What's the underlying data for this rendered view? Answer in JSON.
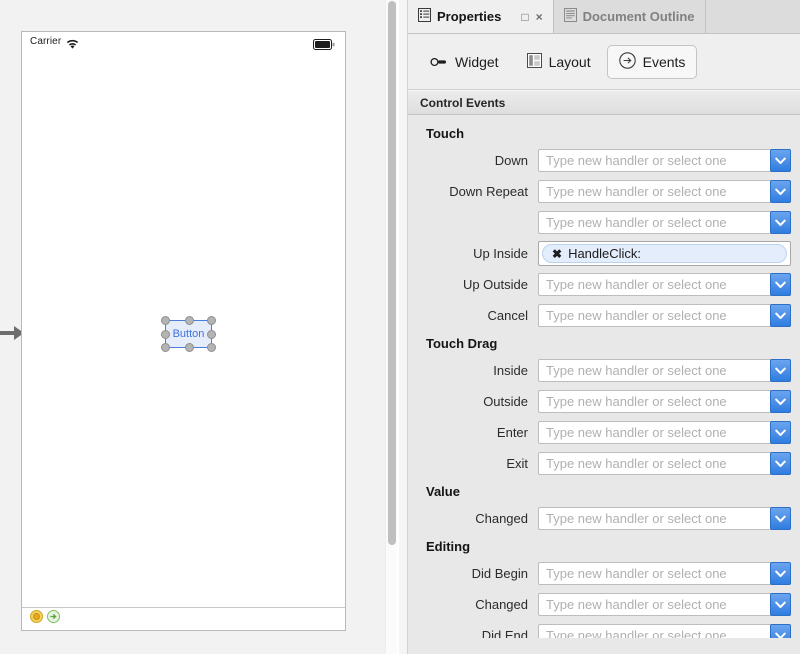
{
  "canvas": {
    "entry_point_icon": "right-arrow-icon",
    "status_bar": {
      "carrier": "Carrier",
      "wifi_icon": "wifi-icon",
      "battery_icon": "battery-icon"
    },
    "widget": {
      "label": "Button",
      "selected": true,
      "border_color": "#4a7ddc",
      "text_color": "#3f74dd"
    },
    "scene_dock": {
      "first_responder_icon": "first-responder-icon",
      "exit_icon": "exit-icon",
      "first_responder_color": "#e8a81e",
      "exit_color": "#7ebf5e"
    }
  },
  "tabs": [
    {
      "label": "Properties",
      "icon": "properties-list-icon",
      "active": true
    },
    {
      "label": "Document Outline",
      "icon": "document-outline-icon",
      "active": false
    }
  ],
  "tab_buttons": {
    "maximize": "□",
    "close": "×"
  },
  "modes": [
    {
      "label": "Widget",
      "icon": "pin-connector-icon",
      "selected": false
    },
    {
      "label": "Layout",
      "icon": "layout-panel-icon",
      "selected": false
    },
    {
      "label": "Events",
      "icon": "circle-arrow-icon",
      "selected": true
    }
  ],
  "section": {
    "title": "Control Events"
  },
  "placeholder": "Type new handler or select one",
  "groups": [
    {
      "title": "Touch",
      "rows": [
        {
          "label": "Down",
          "type": "combo",
          "value": ""
        },
        {
          "label": "Down Repeat",
          "type": "combo",
          "value": ""
        },
        {
          "label": "",
          "type": "combo",
          "value": ""
        },
        {
          "label": "Up Inside",
          "type": "token",
          "value": "HandleClick:"
        },
        {
          "label": "Up Outside",
          "type": "combo",
          "value": ""
        },
        {
          "label": "Cancel",
          "type": "combo",
          "value": ""
        }
      ]
    },
    {
      "title": "Touch Drag",
      "rows": [
        {
          "label": "Inside",
          "type": "combo",
          "value": ""
        },
        {
          "label": "Outside",
          "type": "combo",
          "value": ""
        },
        {
          "label": "Enter",
          "type": "combo",
          "value": ""
        },
        {
          "label": "Exit",
          "type": "combo",
          "value": ""
        }
      ]
    },
    {
      "title": "Value",
      "rows": [
        {
          "label": "Changed",
          "type": "combo",
          "value": ""
        }
      ]
    },
    {
      "title": "Editing",
      "rows": [
        {
          "label": "Did Begin",
          "type": "combo",
          "value": ""
        },
        {
          "label": "Changed",
          "type": "combo",
          "value": ""
        },
        {
          "label": "Did End",
          "type": "combo",
          "value": ""
        }
      ]
    }
  ]
}
